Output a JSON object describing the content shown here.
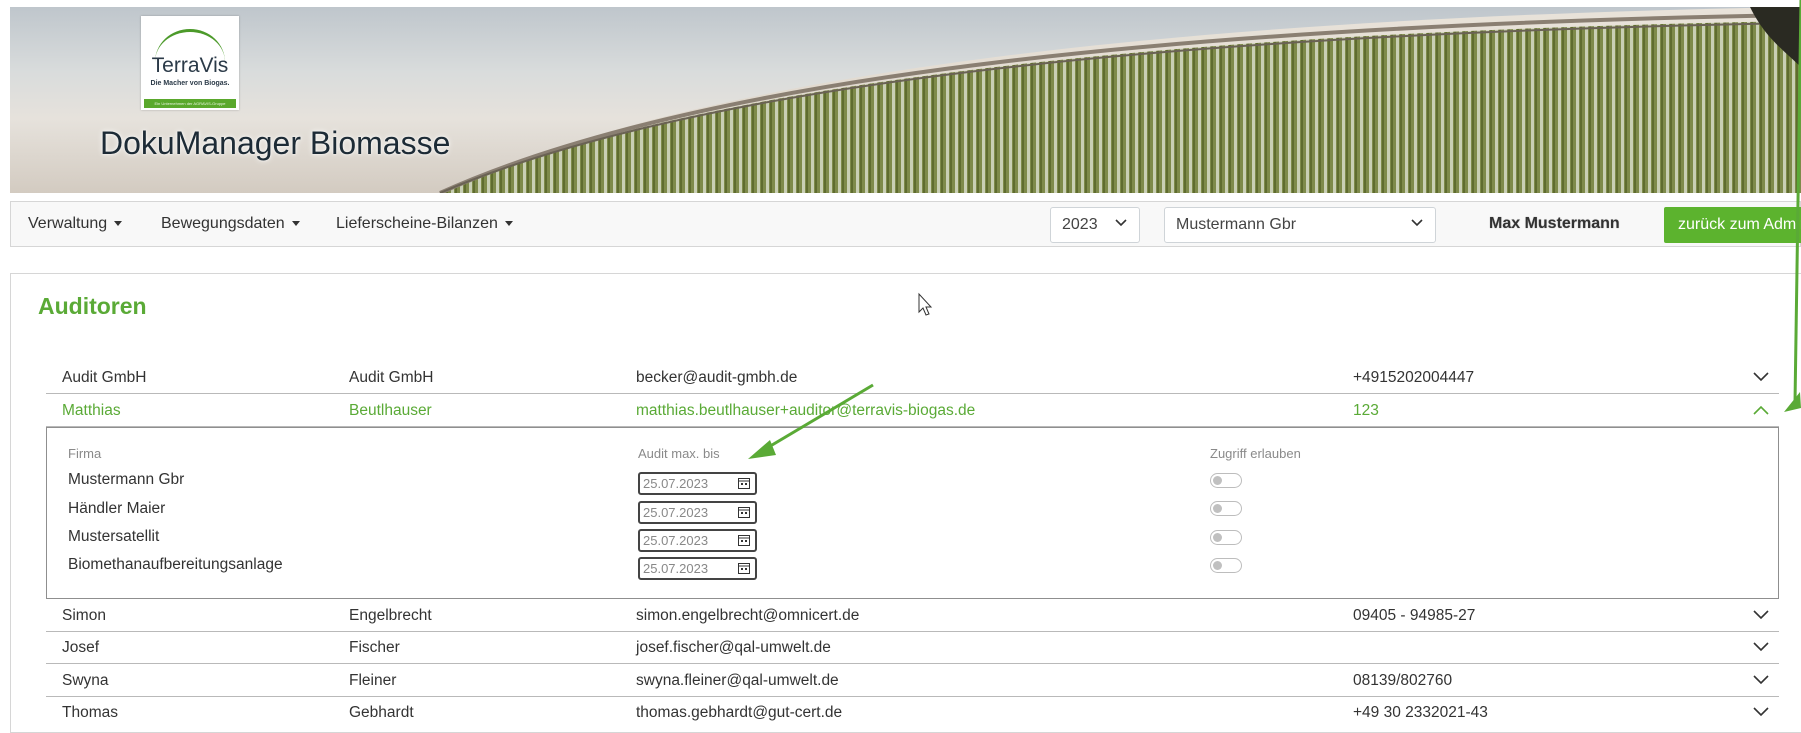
{
  "header": {
    "logo_name": "TerraVis",
    "logo_slogan": "Die Macher von Biogas.",
    "logo_bar": "Ein Unternehmen der AGRAVIS-Gruppe",
    "app_title": "DokuManager Biomasse"
  },
  "nav": {
    "menus": [
      {
        "label": "Verwaltung"
      },
      {
        "label": "Bewegungsdaten"
      },
      {
        "label": "Lieferscheine-Bilanzen"
      }
    ],
    "year_select": "2023",
    "company_select": "Mustermann Gbr",
    "user_name": "Max Mustermann",
    "admin_button": "zurück zum Admin"
  },
  "page": {
    "title": "Auditoren"
  },
  "auditors": [
    {
      "first": "Audit GmbH",
      "last": "Audit GmbH",
      "email": "becker@audit-gmbh.de",
      "phone": "+4915202004447",
      "expanded": false
    },
    {
      "first": "Matthias",
      "last": "Beutlhauser",
      "email": "matthias.beutlhauser+auditor@terravis-biogas.de",
      "phone": "123",
      "expanded": true
    },
    {
      "first": "Simon",
      "last": "Engelbrecht",
      "email": "simon.engelbrecht@omnicert.de",
      "phone": "09405 - 94985-27",
      "expanded": false
    },
    {
      "first": "Josef",
      "last": "Fischer",
      "email": "josef.fischer@qal-umwelt.de",
      "phone": "",
      "expanded": false
    },
    {
      "first": "Swyna",
      "last": "Fleiner",
      "email": "swyna.fleiner@qal-umwelt.de",
      "phone": "08139/802760",
      "expanded": false
    },
    {
      "first": "Thomas",
      "last": "Gebhardt",
      "email": "thomas.gebhardt@gut-cert.de",
      "phone": "+49 30 2332021-43",
      "expanded": false
    }
  ],
  "detail": {
    "headers": {
      "company": "Firma",
      "audit_until": "Audit max. bis",
      "allow_access": "Zugriff erlauben"
    },
    "rows": [
      {
        "company": "Mustermann Gbr",
        "date": "25.07.2023",
        "allowed": false
      },
      {
        "company": "Händler Maier",
        "date": "25.07.2023",
        "allowed": false
      },
      {
        "company": "Mustersatellit",
        "date": "25.07.2023",
        "allowed": false
      },
      {
        "company": "Biomethanaufbereitungsanlage",
        "date": "25.07.2023",
        "allowed": false
      }
    ]
  },
  "colors": {
    "accent": "#5aaa36",
    "button": "#5cb32e"
  }
}
